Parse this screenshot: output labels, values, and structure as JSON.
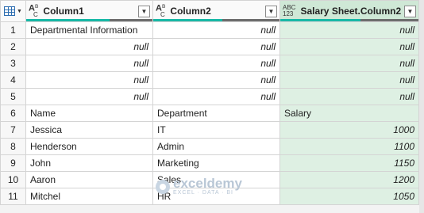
{
  "columns": [
    {
      "type_top": "A",
      "type_sup": "B",
      "type_sub": "C",
      "label": "Column1",
      "selected": false
    },
    {
      "type_top": "A",
      "type_sup": "B",
      "type_sub": "C",
      "label": "Column2",
      "selected": false
    },
    {
      "type_top": "ABC",
      "type_sub": "123",
      "label": "Salary Sheet.Column2",
      "selected": true
    }
  ],
  "quality_fill": [
    0.66,
    0.55,
    0.58
  ],
  "rows": [
    {
      "n": "1",
      "c1": "Departmental Information",
      "c2": "null",
      "c3": "null"
    },
    {
      "n": "2",
      "c1": "null",
      "c2": "null",
      "c3": "null"
    },
    {
      "n": "3",
      "c1": "null",
      "c2": "null",
      "c3": "null"
    },
    {
      "n": "4",
      "c1": "null",
      "c2": "null",
      "c3": "null"
    },
    {
      "n": "5",
      "c1": "null",
      "c2": "null",
      "c3": "null"
    },
    {
      "n": "6",
      "c1": "Name",
      "c2": "Department",
      "c3": "Salary"
    },
    {
      "n": "7",
      "c1": "Jessica",
      "c2": "IT",
      "c3": "1000"
    },
    {
      "n": "8",
      "c1": "Henderson",
      "c2": "Admin",
      "c3": "1100"
    },
    {
      "n": "9",
      "c1": "John",
      "c2": "Marketing",
      "c3": "1150"
    },
    {
      "n": "10",
      "c1": "Aaron",
      "c2": "Sales",
      "c3": "1200"
    },
    {
      "n": "11",
      "c1": "Mitchel",
      "c2": "HR",
      "c3": "1050"
    }
  ],
  "watermark": {
    "name": "exceldemy",
    "tagline": "EXCEL · DATA · BI"
  },
  "icons": {
    "corner": "table-icon",
    "dropdown": "chevron-down-icon"
  }
}
